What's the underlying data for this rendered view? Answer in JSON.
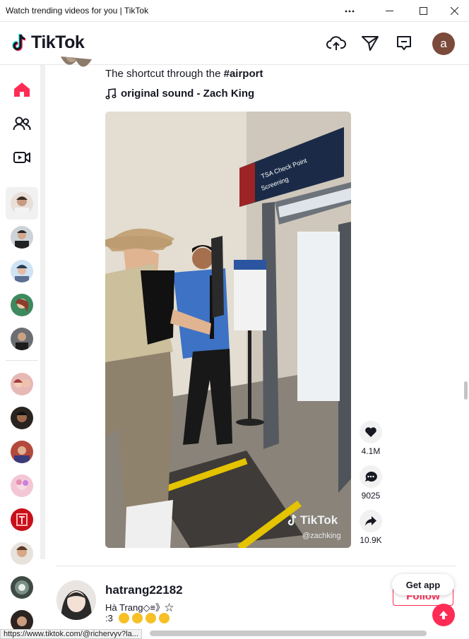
{
  "window": {
    "title": "Watch trending videos for you | TikTok"
  },
  "header": {
    "logo_text": "TikTok",
    "avatar_letter": "a"
  },
  "sidebar": {
    "nav": [
      {
        "label": "For You",
        "icon": "home-icon"
      },
      {
        "label": "Following",
        "icon": "users-icon"
      },
      {
        "label": "LIVE",
        "icon": "live-video-icon"
      }
    ],
    "following_accounts": 5,
    "suggested_accounts": 8
  },
  "post1": {
    "caption_text": "The shortcut through the ",
    "caption_hashtag": "#airport",
    "sound": "original sound - Zach King",
    "video_watermark_brand": "TikTok",
    "video_watermark_user": "@zachking",
    "likes": "4.1M",
    "comments": "9025",
    "shares": "10.9K"
  },
  "post2": {
    "username": "hatrang22182",
    "nickname": "Hà Trang◇≡》☆",
    "caption": ":3",
    "follow_label": "Follow"
  },
  "floating": {
    "get_app_label": "Get app"
  },
  "status": {
    "url": "https://www.tiktok.com/@richervyv?la..."
  },
  "colors": {
    "brand_red": "#fe2c55",
    "text": "#161823",
    "cyan": "#25f4ee"
  }
}
